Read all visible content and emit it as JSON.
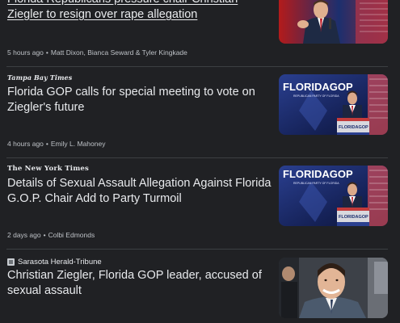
{
  "articles": [
    {
      "source": "",
      "headline": "Florida Republicans pressure chair Christian Ziegler to resign over rape allegation",
      "time": "5 hours ago",
      "authors": "Matt Dixon, Bianca Seward & Tyler Kingkade"
    },
    {
      "source": "Tampa Bay Times",
      "headline": "Florida GOP calls for special meeting to vote on Ziegler's future",
      "time": "4 hours ago",
      "authors": "Emily L. Mahoney",
      "thumb_banner": "FLORIDAGOP",
      "thumb_sub": "REPUBLICAN PARTY OF FLORIDA",
      "thumb_podium": "FLORIDAGOP"
    },
    {
      "source": "The New York Times",
      "headline": "Details of Sexual Assault Allegation Against Florida G.O.P. Chair Add to Party Turmoil",
      "time": "2 days ago",
      "authors": "Colbi Edmonds",
      "thumb_banner": "FLORIDAGOP",
      "thumb_sub": "REPUBLICAN PARTY OF FLORIDA",
      "thumb_podium": "FLORIDAGOP"
    },
    {
      "source": "Sarasota Herald-Tribune",
      "headline": "Christian Ziegler, Florida GOP leader, accused of sexual assault",
      "time": "",
      "authors": ""
    }
  ],
  "meta_separator": "•"
}
